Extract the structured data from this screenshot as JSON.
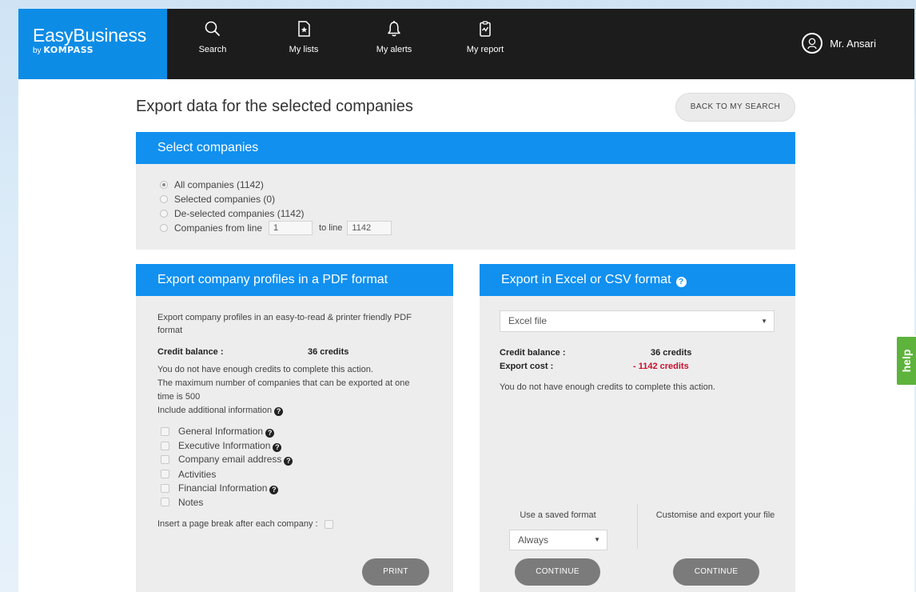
{
  "header": {
    "brand": "EasyBusiness",
    "brand_by": "by",
    "brand_company": "KOMPASS",
    "nav": [
      {
        "label": "Search",
        "icon": "search-icon"
      },
      {
        "label": "My lists",
        "icon": "list-star-icon"
      },
      {
        "label": "My alerts",
        "icon": "bell-icon"
      },
      {
        "label": "My report",
        "icon": "report-clipboard-icon"
      }
    ],
    "user_name": "Mr. Ansari",
    "user_icon": "user-avatar-icon"
  },
  "page": {
    "title": "Export data for the selected companies",
    "back_button": "BACK TO MY SEARCH"
  },
  "select_companies": {
    "heading": "Select companies",
    "options": [
      {
        "label": "All companies (1142)",
        "checked": true
      },
      {
        "label": "Selected companies (0)",
        "checked": false
      },
      {
        "label": "De-selected companies (1142)",
        "checked": false
      },
      {
        "label": "Companies from line",
        "checked": false
      }
    ],
    "from_line": "1",
    "to_line_label": "to line",
    "to_line": "1142"
  },
  "pdf_export": {
    "heading": "Export company profiles in a PDF format",
    "description": "Export company profiles in an easy-to-read & printer friendly PDF format",
    "credit_label": "Credit balance :",
    "credit_value": "36 credits",
    "not_enough": "You do not have enough credits to complete this action.",
    "max_note": "The maximum number of companies that can be exported at one time is 500",
    "include_label": "Include additional information",
    "options": [
      {
        "label": "General Information",
        "help": true
      },
      {
        "label": "Executive Information",
        "help": true
      },
      {
        "label": "Company email address",
        "help": true
      },
      {
        "label": "Activities",
        "help": false
      },
      {
        "label": "Financial Information",
        "help": true
      },
      {
        "label": "Notes",
        "help": false
      }
    ],
    "page_break_label": "Insert a page break after each company :",
    "print_button": "PRINT"
  },
  "excel_export": {
    "heading": "Export in Excel or CSV format",
    "format_selected": "Excel file",
    "credit_label": "Credit balance :",
    "credit_value": "36 credits",
    "cost_label": "Export cost :",
    "cost_value": "- 1142 credits",
    "not_enough": "You do not have enough credits to complete this action.",
    "saved_format_label": "Use a saved format",
    "saved_format_selected": "Always",
    "customise_label": "Customise and export your file",
    "continue_left": "CONTINUE",
    "continue_right": "CONTINUE"
  },
  "help_tab": "help",
  "colors": {
    "brand_blue": "#1190ef",
    "header_dark": "#1c1c1c",
    "panel_bg": "#ededed",
    "cost_red": "#c8102e",
    "help_green": "#5db33b"
  }
}
